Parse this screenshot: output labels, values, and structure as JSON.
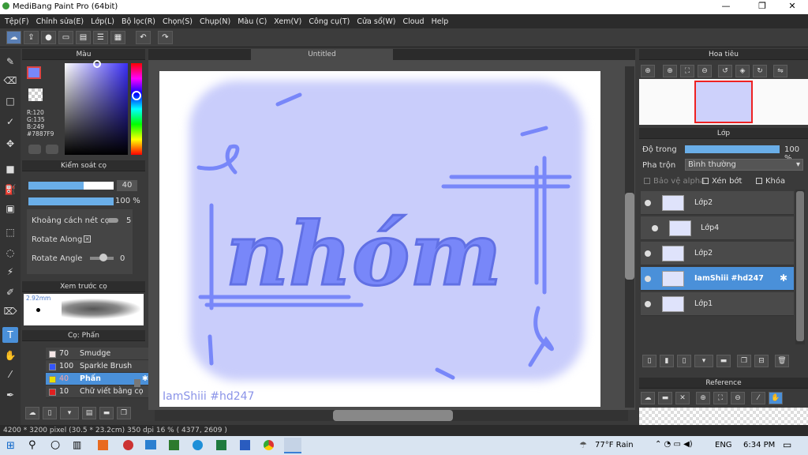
{
  "app_title": "MediBang Paint Pro (64bit)",
  "menu": [
    "Tệp(F)",
    "Chỉnh sửa(E)",
    "Lớp(L)",
    "Bộ lọc(R)",
    "Chọn(S)",
    "Chụp(N)",
    "Màu (C)",
    "Xem(V)",
    "Công cụ(T)",
    "Cửa sổ(W)",
    "Cloud",
    "Help"
  ],
  "color_panel": {
    "title": "Màu",
    "r": "R:120",
    "g": "G:135",
    "b": "B:249",
    "hex": "#7887F9"
  },
  "brush_control": {
    "title": "Kiểm soát cọ",
    "size": "40",
    "opacity": "100 %",
    "spacing_label": "Khoảng cách nét cọ",
    "spacing_value": "5",
    "rotate_along": "Rotate Along",
    "rotate_angle": "Rotate Angle",
    "rotate_angle_value": "0"
  },
  "brush_preview": {
    "title": "Xem trước cọ",
    "size": "2.92mm"
  },
  "brush_list": {
    "title": "Cọ: Phấn",
    "items": [
      {
        "size": "70",
        "name": "Smudge",
        "color": "#f5e6e6"
      },
      {
        "size": "100",
        "name": "Sparkle Brush",
        "color": "#3355ff"
      },
      {
        "size": "40",
        "name": "Phấn",
        "color": "#e8e000"
      },
      {
        "size": "10",
        "name": "Chữ viết bằng cọ",
        "color": "#e02020"
      }
    ]
  },
  "document_tab": "Untitled",
  "canvas": {
    "watermark": "IamShiii #hd247",
    "word": "nhóm"
  },
  "navigator": {
    "title": "Hoa tiêu"
  },
  "layers": {
    "title": "Lớp",
    "opacity_label": "Độ trong",
    "opacity_value": "100 %",
    "blend_label": "Pha trộn",
    "blend_value": "Bình thường",
    "protect_alpha": "Bảo vệ alpha",
    "clipping": "Xén bớt",
    "lock": "Khóa",
    "items": [
      {
        "name": "Lớp2"
      },
      {
        "name": "Lớp4"
      },
      {
        "name": "Lớp2"
      },
      {
        "name": "IamShiii #hd247"
      },
      {
        "name": "Lớp1"
      }
    ]
  },
  "reference": {
    "title": "Reference"
  },
  "status": {
    "size": "4200 * 3200 pixel",
    "cm": "(30.5 * 23.2cm)",
    "dpi": "350 dpi",
    "zoom": "16 %",
    "coords": "( 4377, 2609 )"
  },
  "taskbar": {
    "weather": "77°F  Rain",
    "lang": "ENG",
    "time": "6:34 PM"
  },
  "colors": {
    "accent": "#4a90d9",
    "paint": "#7887F9",
    "bg_paint": "#c9cdfb"
  }
}
